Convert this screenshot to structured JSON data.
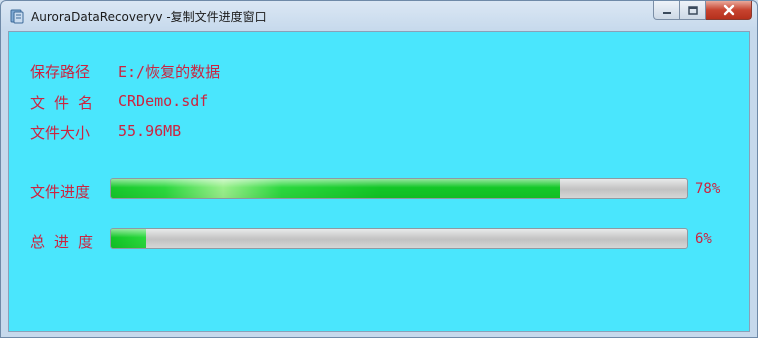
{
  "window": {
    "title": "AuroraDataRecoveryv -复制文件进度窗口"
  },
  "info": {
    "save_path_label": "保存路径",
    "save_path_value": "E:/恢复的数据",
    "file_name_label": "文 件 名",
    "file_name_value": "CRDemo.sdf",
    "file_size_label": "文件大小",
    "file_size_value": "55.96MB"
  },
  "progress": {
    "file_label": "文件进度",
    "file_percent_text": "78%",
    "file_value": 0.78,
    "total_label": "总 进 度",
    "total_percent_text": "6%",
    "total_value": 0.06
  },
  "colors": {
    "background": "#4ae6fd",
    "text": "#cc2440",
    "progress_fill": "#12c626"
  },
  "icons": {
    "app": "app-icon",
    "minimize": "minimize-icon",
    "maximize": "maximize-icon",
    "close": "close-icon"
  }
}
